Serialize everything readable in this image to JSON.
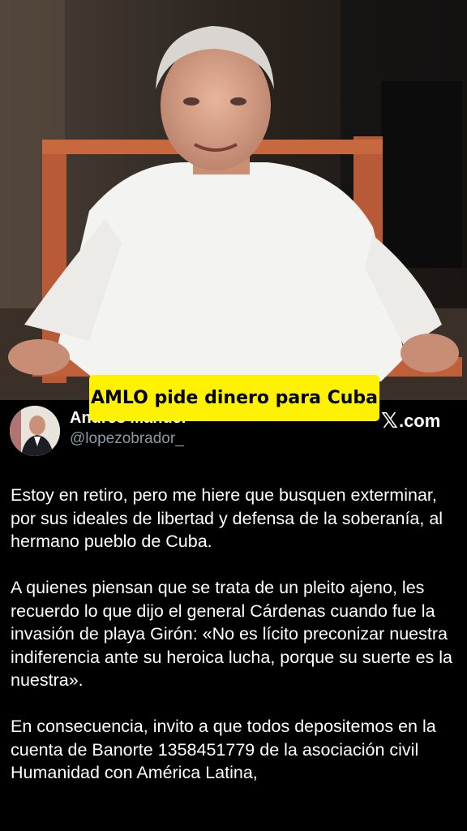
{
  "caption": "AMLO pide dinero para Cuba",
  "tweet": {
    "author_name": "Andrés Manuel",
    "handle": "@lopezobrador_",
    "source": ".com",
    "paragraphs": [
      "Estoy en retiro, pero me hiere que busquen exterminar, por sus ideales de libertad y defensa de la soberanía, al hermano pueblo de Cuba.",
      "A quienes piensan que se trata de un pleito ajeno, les recuerdo lo que dijo el general Cárdenas cuando fue la invasión de playa Girón: «No es lícito preconizar nuestra indiferencia ante su heroica lucha, porque su suerte es la nuestra».",
      "En consecuencia, invito a que todos depositemos en la cuenta de Banorte 1358451779 de la asociación civil Humanidad con América Latina,"
    ]
  },
  "colors": {
    "caption_bg": "#fff200",
    "handle": "#8b98a5",
    "background": "#000000"
  }
}
